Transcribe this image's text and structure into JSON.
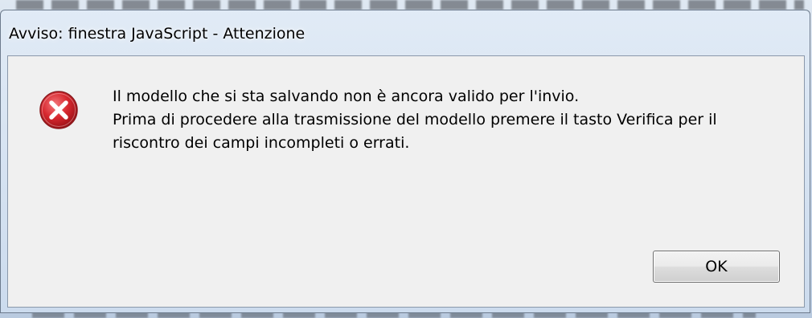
{
  "dialog": {
    "title": "Avviso: finestra JavaScript - Attenzione",
    "icon": "error-icon",
    "message_line_1": "Il modello che si sta salvando non è ancora valido per l'invio.",
    "message_line_2": "Prima di procedere alla trasmissione del modello premere il tasto Verifica per il riscontro dei campi incompleti o errati.",
    "ok_label": "OK"
  },
  "colors": {
    "error_red": "#d7282f",
    "client_bg": "#f0f0f0"
  }
}
